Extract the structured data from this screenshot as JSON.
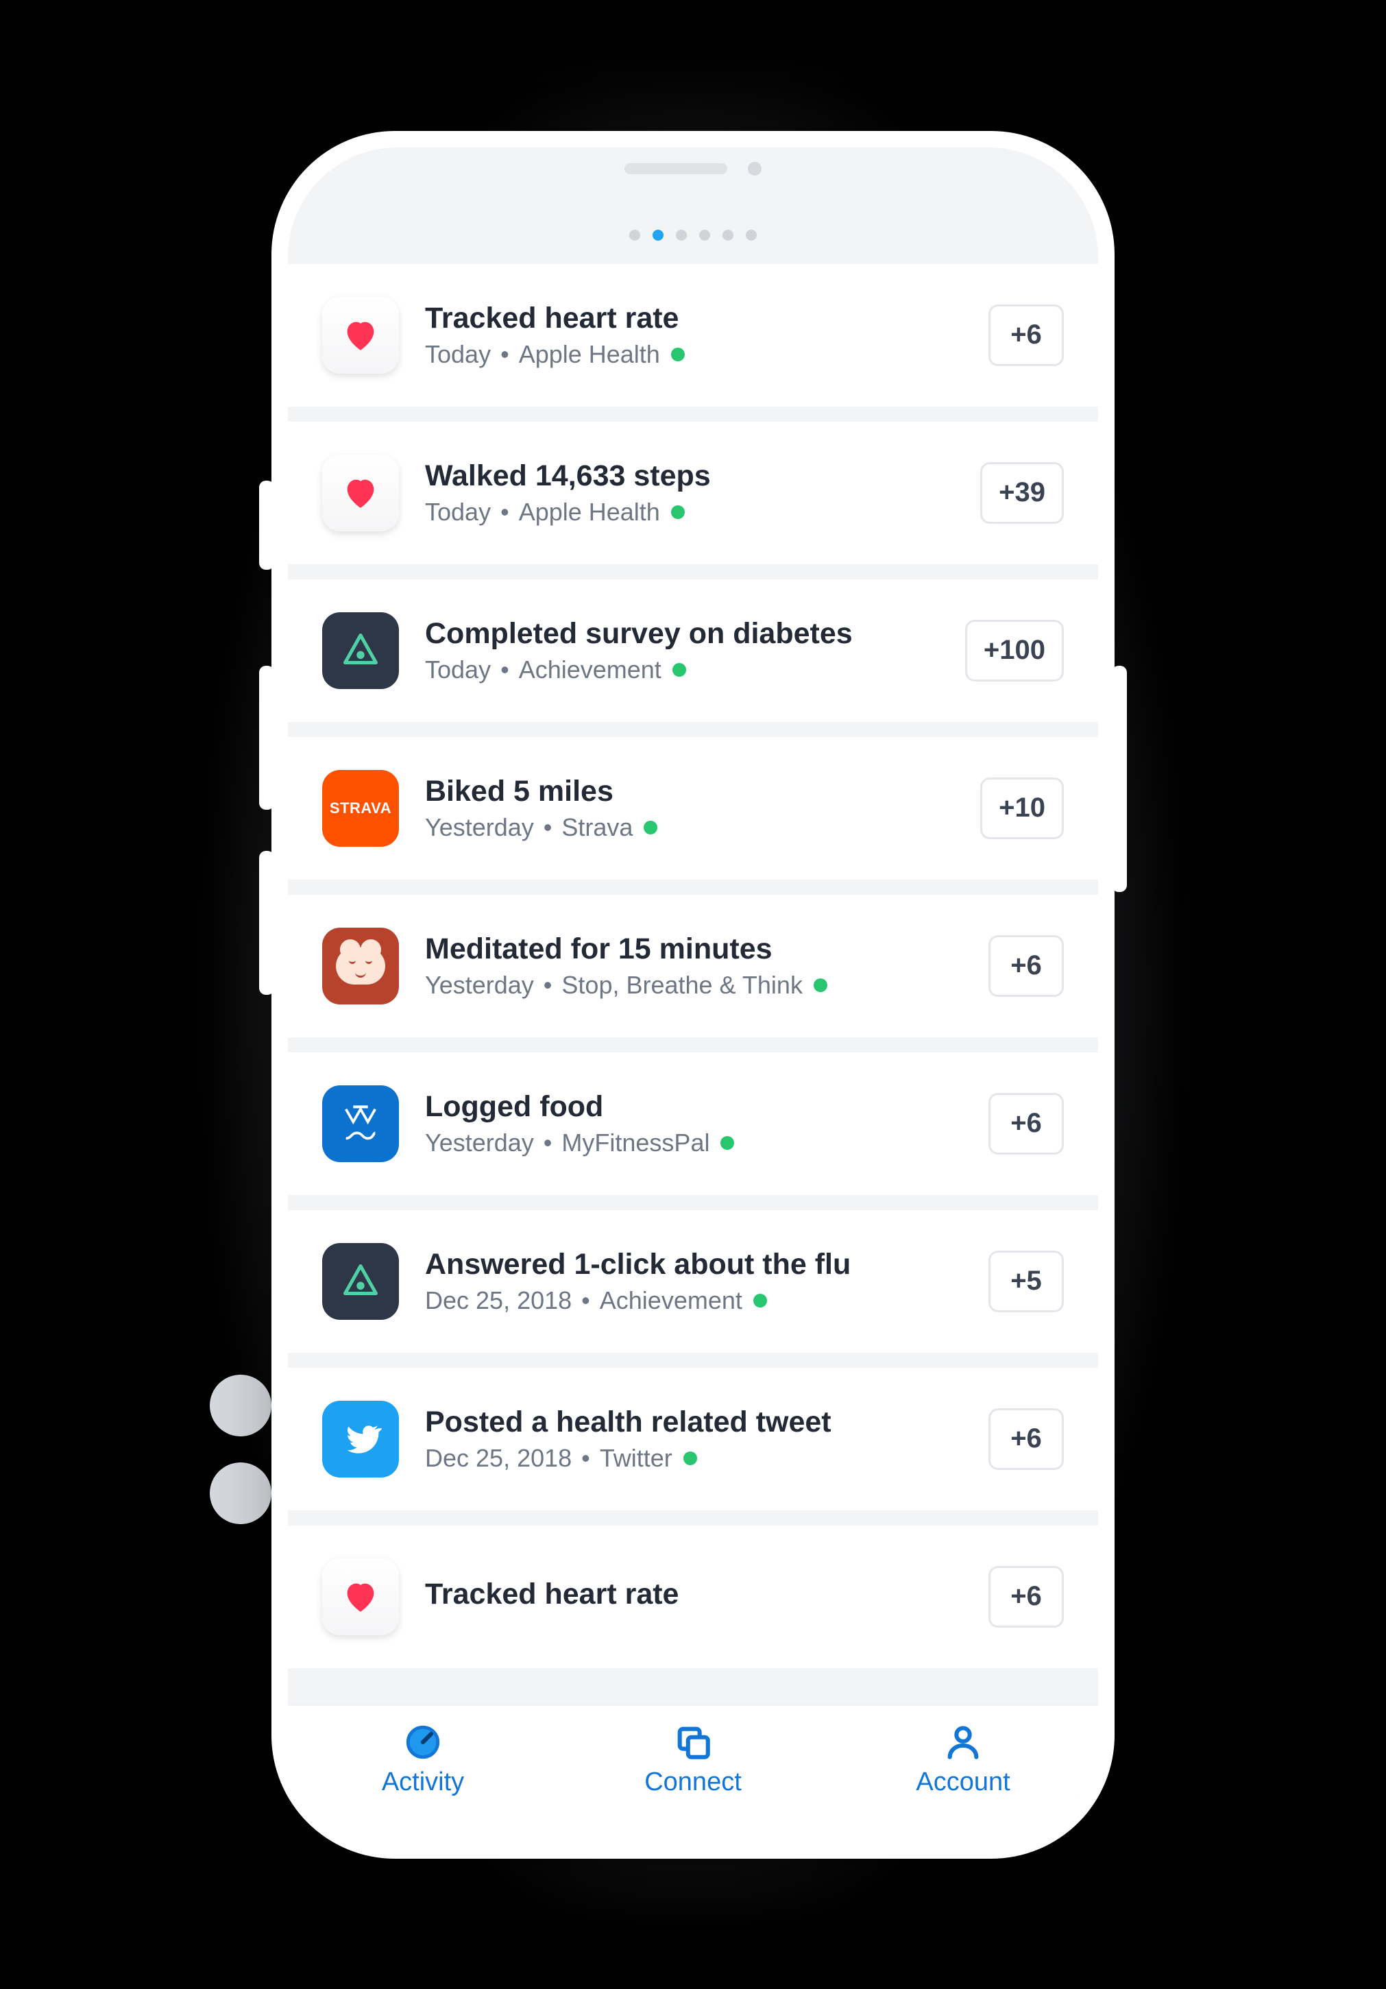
{
  "pageDots": {
    "count": 6,
    "activeIndex": 1
  },
  "feed": [
    {
      "icon": "apple-health",
      "title": "Tracked heart rate",
      "date": "Today",
      "source": "Apple Health",
      "points": "+6",
      "statusDot": true
    },
    {
      "icon": "apple-health",
      "title": "Walked 14,633 steps",
      "date": "Today",
      "source": "Apple Health",
      "points": "+39",
      "statusDot": true
    },
    {
      "icon": "achievement",
      "title": "Completed survey on diabetes",
      "date": "Today",
      "source": "Achievement",
      "points": "+100",
      "statusDot": true
    },
    {
      "icon": "strava",
      "title": "Biked 5 miles",
      "date": "Yesterday",
      "source": "Strava",
      "points": "+10",
      "statusDot": true
    },
    {
      "icon": "meditate",
      "title": "Meditated for 15 minutes",
      "date": "Yesterday",
      "source": "Stop, Breathe & Think",
      "points": "+6",
      "statusDot": true
    },
    {
      "icon": "myfitnesspal",
      "title": "Logged food",
      "date": "Yesterday",
      "source": "MyFitnessPal",
      "points": "+6",
      "statusDot": true
    },
    {
      "icon": "achievement",
      "title": "Answered 1-click about the flu",
      "date": "Dec 25, 2018",
      "source": "Achievement",
      "points": "+5",
      "statusDot": true
    },
    {
      "icon": "twitter",
      "title": "Posted a health related tweet",
      "date": "Dec 25, 2018",
      "source": "Twitter",
      "points": "+6",
      "statusDot": true
    },
    {
      "icon": "apple-health",
      "title": "Tracked heart rate",
      "date": "",
      "source": "",
      "points": "+6",
      "statusDot": false
    }
  ],
  "tabs": {
    "activity": "Activity",
    "connect": "Connect",
    "account": "Account"
  },
  "icons": {
    "strava_label": "STRAVA"
  }
}
